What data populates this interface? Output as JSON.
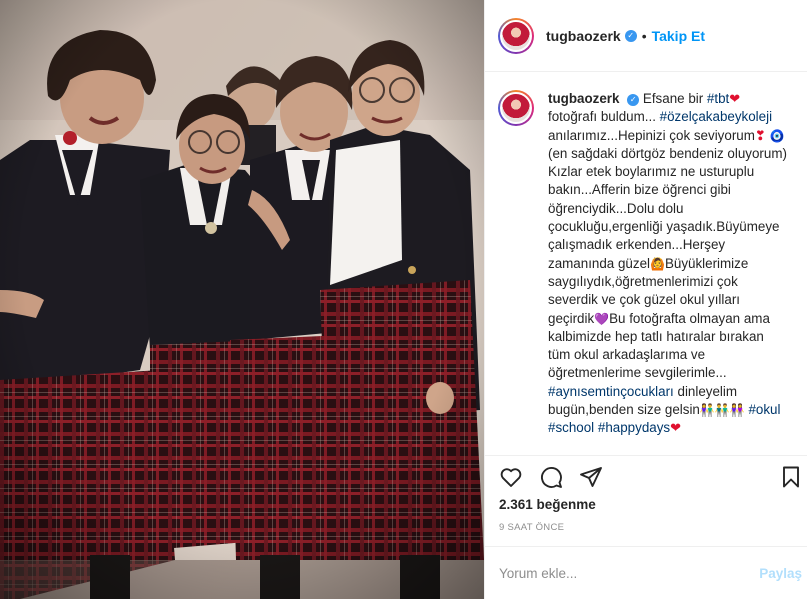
{
  "header": {
    "username": "tugbaozerk",
    "separator": "•",
    "follow_label": "Takip Et"
  },
  "caption": {
    "username": "tugbaozerk",
    "text_1": "Efsane bir ",
    "tag_tbt": "#tbt",
    "text_2": "fotoğrafı buldum... ",
    "tag_school_name": "#özelçakabeykoleji",
    "text_3": "anılarımız...Hepinizi çok seviyorum",
    "text_4": " (en sağdaki dörtgöz bendeniz oluyorum) Kızlar etek boylarımız ne usturuplu bakın...Afferin bize öğrenci gibi öğrenciydik...Dolu dolu çocukluğu,ergenliği yaşadık.Büyümeye çalışmadık erkenden...Herşey zamanında güzel",
    "text_5": "Büyüklerimize saygılıydık,öğretmenlerimizi çok severdik ve çok güzel okul yılları geçirdik",
    "text_6": "Bu fotoğrafta olmayan ama kalbimizde hep tatlı hatıralar bırakan tüm okul arkadaşlarıma ve öğretmenlerime sevgilerimle...",
    "tag_ayni": "#aynısemtinçocukları",
    "text_7": " dinleyelim bugün,benden size gelsin",
    "tag_okul": "#okul",
    "tag_school": "#school",
    "tag_happydays": "#happydays"
  },
  "emoji": {
    "red_heart": "❤",
    "heart_exclamation": "❣",
    "nazar": "🧿",
    "gesture": "🙆",
    "purple_heart": "💜",
    "people": "👫👬👭"
  },
  "icons": {
    "like": "heart-outline-icon",
    "comment": "comment-bubble-icon",
    "share": "paper-plane-icon",
    "save": "bookmark-icon",
    "verified": "verified-badge-icon",
    "verified_glyph": "✓"
  },
  "stats": {
    "likes": "2.361 beğenme",
    "time_ago": "9 SAAT ÖNCE"
  },
  "comment": {
    "placeholder": "Yorum ekle...",
    "post_label": "Paylaş"
  },
  "colors": {
    "accent_blue": "#0095f6",
    "tag_blue": "#00376b",
    "heart_red": "#e0102f",
    "muted": "#8e8e8e",
    "post_disabled": "#b2dffc"
  }
}
